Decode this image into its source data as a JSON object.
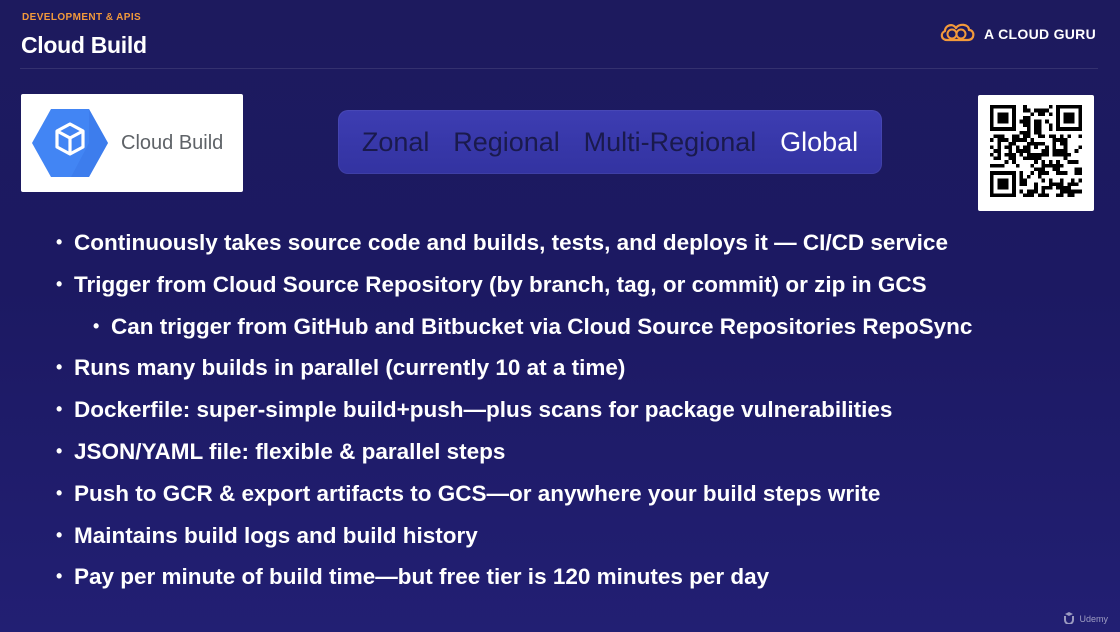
{
  "header": {
    "category": "DEVELOPMENT & APIS",
    "title": "Cloud Build",
    "brand": "A CLOUD GURU",
    "brand_icon": "cloud-icon"
  },
  "product": {
    "name": "Cloud Build",
    "icon": "cloud-build-hexagon-icon",
    "icon_color": "#4285f4"
  },
  "scopes": [
    {
      "label": "Zonal",
      "active": false
    },
    {
      "label": "Regional",
      "active": false
    },
    {
      "label": "Multi-Regional",
      "active": false
    },
    {
      "label": "Global",
      "active": true
    }
  ],
  "qr_code": {
    "icon": "qr-code-icon"
  },
  "bullets": [
    {
      "text": "Continuously takes source code and builds, tests, and deploys it  — CI/CD service",
      "level": 1
    },
    {
      "text": "Trigger from Cloud Source Repository (by branch, tag, or commit) or zip in GCS",
      "level": 1
    },
    {
      "text": "Can trigger from GitHub and Bitbucket via Cloud Source Repositories RepoSync",
      "level": 2
    },
    {
      "text": "Runs many builds in parallel (currently 10 at a time)",
      "level": 1
    },
    {
      "text": "Dockerfile: super-simple build+push—plus scans for package vulnerabilities",
      "level": 1
    },
    {
      "text": "JSON/YAML file: flexible & parallel steps",
      "level": 1
    },
    {
      "text": "Push to GCR & export artifacts to GCS—or anywhere your build steps write",
      "level": 1
    },
    {
      "text": "Maintains build logs and build history",
      "level": 1
    },
    {
      "text": "Pay per minute of build time—but free tier is 120 minutes per day",
      "level": 1
    }
  ],
  "watermark": {
    "text": "Udemy",
    "icon": "udemy-logo-icon"
  },
  "colors": {
    "background": "#1d1a5e",
    "accent_orange": "#f39a3b",
    "scope_bar": "#3636a8",
    "scope_inactive_text": "#1a1a4d",
    "scope_active_text": "#ffffff"
  }
}
